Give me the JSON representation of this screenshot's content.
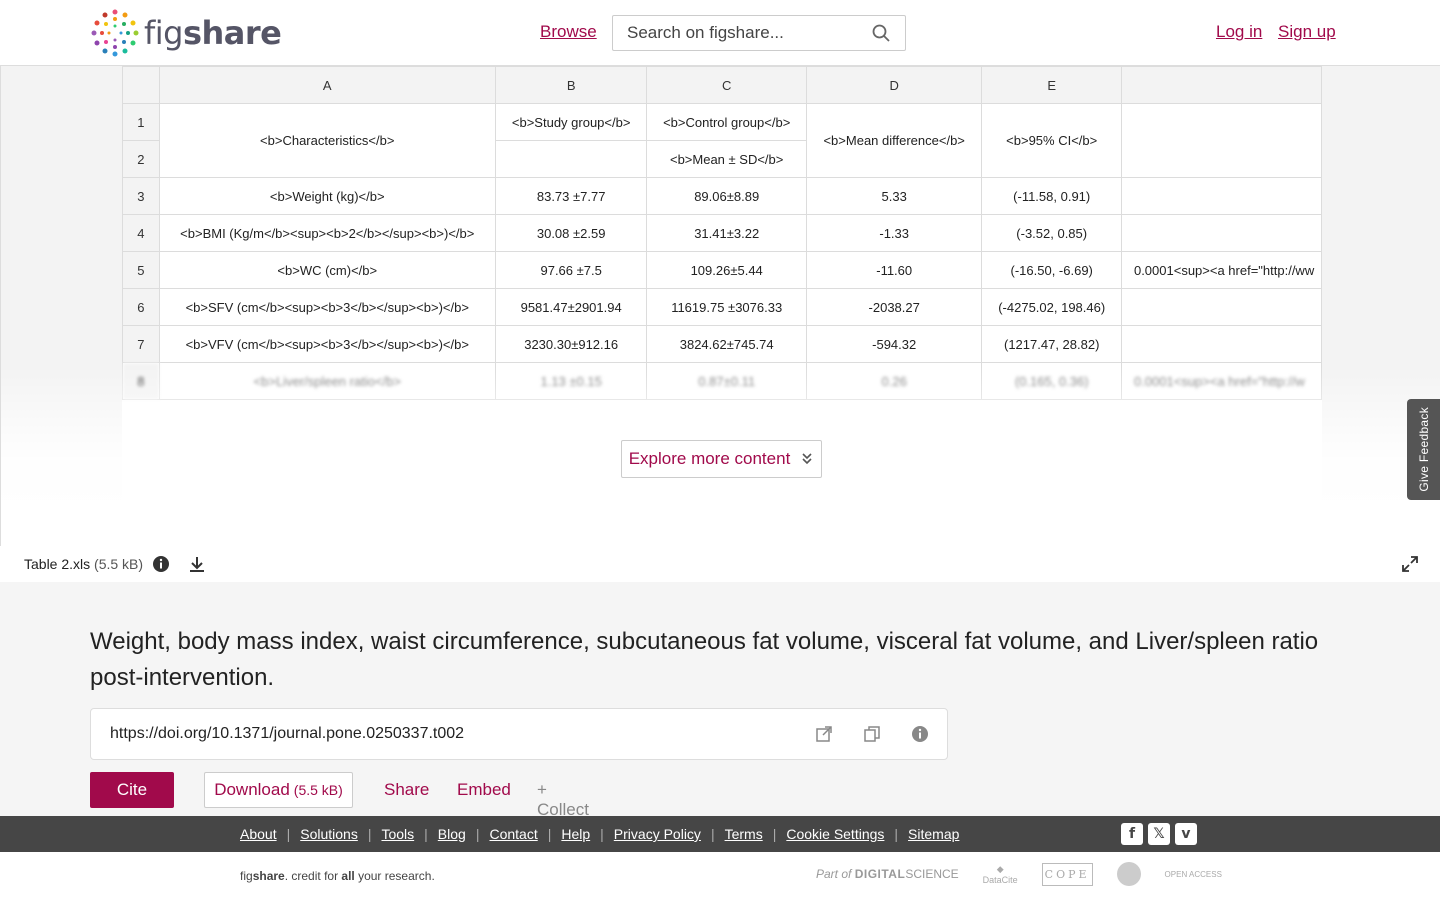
{
  "header": {
    "logo_text_fig": "fig",
    "logo_text_share": "share",
    "browse": "Browse",
    "search_placeholder": "Search on figshare...",
    "login": "Log in",
    "signup": "Sign up"
  },
  "sheet": {
    "columns": [
      "",
      "A",
      "B",
      "C",
      "D",
      "E",
      ""
    ],
    "rows": [
      {
        "n": "1",
        "a": "<b>Characteristics</b>",
        "b": "<b>Study group</b>",
        "c": "<b>Control group</b>",
        "d": "<b>Mean difference</b>",
        "e": "<b>95% CI</b>",
        "f": ""
      },
      {
        "n": "2",
        "b": "",
        "c": "<b>Mean ± SD</b>"
      },
      {
        "n": "3",
        "a": "<b>Weight (kg)</b>",
        "b": "83.73 ±7.77",
        "c": "89.06±8.89",
        "d": "5.33",
        "e": "(-11.58, 0.91)",
        "f": ""
      },
      {
        "n": "4",
        "a": "<b>BMI (Kg/m</b><sup><b>2</b></sup><b>)</b>",
        "b": "30.08 ±2.59",
        "c": "31.41±3.22",
        "d": "-1.33",
        "e": "(-3.52, 0.85)",
        "f": ""
      },
      {
        "n": "5",
        "a": "<b>WC (cm)</b>",
        "b": "97.66 ±7.5",
        "c": "109.26±5.44",
        "d": "-11.60",
        "e": "(-16.50, -6.69)",
        "f": "0.0001<sup><a href=\"http://ww"
      },
      {
        "n": "6",
        "a": "<b>SFV (cm</b><sup><b>3</b></sup><b>)</b>",
        "b": "9581.47±2901.94",
        "c": "11619.75 ±3076.33",
        "d": "-2038.27",
        "e": "(-4275.02, 198.46)",
        "f": ""
      },
      {
        "n": "7",
        "a": "<b>VFV (cm</b><sup><b>3</b></sup><b>)</b>",
        "b": "3230.30±912.16",
        "c": "3824.62±745.74",
        "d": "-594.32",
        "e": "(1217.47, 28.82)",
        "f": ""
      },
      {
        "n": "8",
        "a": "<b>Liver/spleen ratio</b>",
        "b": "1.13 ±0.15",
        "c": "0.87±0.11",
        "d": "0.26",
        "e": "(0.165, 0.36)",
        "f": "0.0001<sup><a href=\"http://w"
      }
    ]
  },
  "viewer": {
    "explore": "Explore more content",
    "feedback": "Give Feedback",
    "filename": "Table 2.xls",
    "filesize": "(5.5 kB)"
  },
  "main": {
    "title": "Weight, body mass index, waist circumference, subcutaneous fat volume, visceral fat volume, and Liver/spleen ratio post-intervention.",
    "doi": "https://doi.org/10.1371/journal.pone.0250337.t002",
    "cite": "Cite",
    "download": "Download",
    "download_size": "(5.5 kB)",
    "share": "Share",
    "embed": "Embed",
    "collect": "+ Collect"
  },
  "footer": {
    "links": [
      "About",
      "Solutions",
      "Tools",
      "Blog",
      "Contact",
      "Help",
      "Privacy Policy",
      "Terms",
      "Cookie Settings",
      "Sitemap"
    ],
    "tagline_fig": "fig",
    "tagline_share": "share",
    "tagline_rest1": ". credit for ",
    "tagline_all": "all",
    "tagline_rest2": " your research.",
    "partner_ds_prefix": "Part of",
    "partner_ds": "DIGITAL",
    "partner_ds_suffix": "SCIENCE",
    "partner_dc": "DataCite",
    "partner_cope": "COPE",
    "partner_oa": "OPEN ACCESS"
  },
  "icons": {
    "search": "search-icon",
    "info": "info-icon",
    "download": "download-icon",
    "expand": "expand-icon",
    "external": "external-link-icon",
    "copy": "copy-icon",
    "chevrons": "double-chevron-down-icon",
    "facebook": "facebook-icon",
    "x": "x-icon",
    "vimeo": "vimeo-icon"
  },
  "colors": {
    "brand": "#a10a4b",
    "footer": "#464646"
  }
}
